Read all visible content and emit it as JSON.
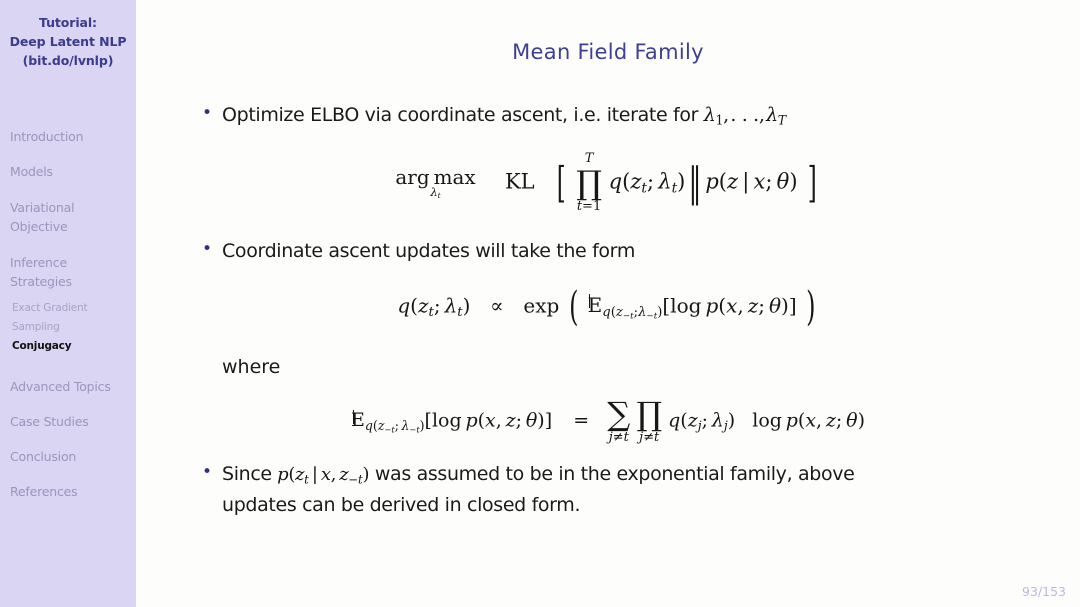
{
  "sidebar": {
    "title_lines": [
      "Tutorial:",
      "Deep Latent NLP",
      "(bit.do/lvnlp)"
    ],
    "items": [
      {
        "label": "Introduction",
        "level": "top",
        "active": false
      },
      {
        "label": "Models",
        "level": "top",
        "active": false
      },
      {
        "label": "Variational Objective",
        "level": "top",
        "active": false
      },
      {
        "label": "Inference Strategies",
        "level": "top",
        "active": false
      },
      {
        "label": "Exact Gradient",
        "level": "sub",
        "active": false
      },
      {
        "label": "Sampling",
        "level": "sub",
        "active": false
      },
      {
        "label": "Conjugacy",
        "level": "sub",
        "active": true
      },
      {
        "label": "Advanced Topics",
        "level": "top",
        "active": false
      },
      {
        "label": "Case Studies",
        "level": "top",
        "active": false
      },
      {
        "label": "Conclusion",
        "level": "top",
        "active": false
      },
      {
        "label": "References",
        "level": "top",
        "active": false
      }
    ],
    "colors": {
      "background": "#D9D5F2",
      "title": "#3B3B8F",
      "item": "#9A96BE",
      "active": "#111111"
    }
  },
  "slide": {
    "title": "Mean Field Family",
    "title_color": "#3F3F95",
    "page_number": "93/153",
    "bullets": [
      {
        "id": "bullet-optimize-elbo",
        "text_before": "Optimize ELBO via coordinate ascent, i.e. iterate for",
        "math_inline": "λ₁, … , λ_T"
      },
      {
        "id": "bullet-coordinate-ascent",
        "text": "Coordinate ascent updates will take the form"
      },
      {
        "id": "bullet-exponential-family",
        "text_line1_before": "Since",
        "math_inline": "p(z_t | x, z_{-t})",
        "text_line1_after": "was assumed to be in the exponential family, above",
        "text_line2": "updates can be derived in closed form."
      }
    ],
    "where_label": "where",
    "equations": [
      {
        "id": "equation-argmax-kl",
        "latex": "\\arg\\max_{\\lambda_t}\\ \\mathrm{KL}\\left[\\prod_{t=1}^{T} q(z_t;\\ \\lambda_t)\\,\\|\\,p(z\\mid x;\\ \\theta)\\right]",
        "parts": {
          "operator": "arg max",
          "operator_sub": "λ_t",
          "functional": "KL",
          "product_upper": "T",
          "product_lower": "t=1",
          "q_term": "q(z_t; λ_t)",
          "divider": "‖",
          "p_term": "p(z | x; θ)"
        }
      },
      {
        "id": "equation-coordinate-update",
        "latex": "q(z_t;\\ \\lambda_t) \\propto \\exp\\left(\\mathbb{E}_{q(z_{-t};\\lambda_{-t})}[\\log p(x,z;\\ \\theta)]\\right)",
        "parts": {
          "lhs": "q(z_t; λ_t)",
          "relation": "∝",
          "exp": "exp",
          "expectation_sub": "q(z_{-t}; λ_{-t})",
          "inner": "log p(x, z; θ)"
        }
      },
      {
        "id": "equation-expectation-expansion",
        "latex": "\\mathbb{E}_{q(z_{-t};\\lambda_{-t})}[\\log p(x,z;\\ \\theta)] = \\sum_{j\\neq t}\\prod_{j\\neq t} q(z_j;\\ \\lambda_j)\\log p(x,z;\\ \\theta)",
        "parts": {
          "expectation_sub": "q(z_{-t}; λ_{-t})",
          "inner": "log p(x, z; θ)",
          "equals": "=",
          "sum_sub": "j≠t",
          "product_sub": "j≠t",
          "q_term": "q(z_j; λ_j)",
          "log_term": "log p(x, z; θ)"
        }
      }
    ]
  }
}
